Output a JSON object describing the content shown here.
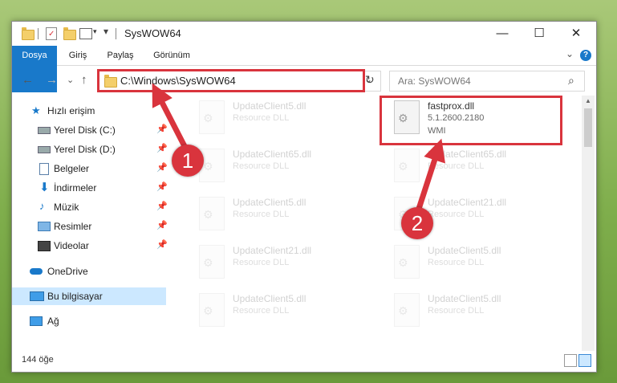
{
  "window": {
    "title": "SysWOW64",
    "minimize": "—",
    "maximize": "☐",
    "close": "✕"
  },
  "ribbon": {
    "tabs": [
      "Dosya",
      "Giriş",
      "Paylaş",
      "Görünüm"
    ],
    "help_icon": "?",
    "expand_icon": "⌄"
  },
  "address": {
    "back": "←",
    "forward": "→",
    "recent": "⌄",
    "up": "↑",
    "path": "C:\\Windows\\SysWOW64",
    "dropdown": "⌄",
    "refresh": "↻",
    "search_placeholder": "Ara: SysWOW64",
    "search_icon": "⌕"
  },
  "sidebar": {
    "items": [
      {
        "label": "Hızlı erişim",
        "icon": "star-icon",
        "pinned": false
      },
      {
        "label": "Yerel Disk (C:)",
        "icon": "drive-icon",
        "pinned": true
      },
      {
        "label": "Yerel Disk (D:)",
        "icon": "drive-icon",
        "pinned": true
      },
      {
        "label": "Belgeler",
        "icon": "documents-icon",
        "pinned": true
      },
      {
        "label": "İndirmeler",
        "icon": "download-icon",
        "pinned": true
      },
      {
        "label": "Müzik",
        "icon": "music-icon",
        "pinned": true
      },
      {
        "label": "Resimler",
        "icon": "pictures-icon",
        "pinned": true
      },
      {
        "label": "Videolar",
        "icon": "video-icon",
        "pinned": true
      },
      {
        "label": "OneDrive",
        "icon": "cloud-icon",
        "pinned": false
      },
      {
        "label": "Bu bilgisayar",
        "icon": "computer-icon",
        "pinned": false
      },
      {
        "label": "Ağ",
        "icon": "network-icon",
        "pinned": false
      }
    ],
    "pin_glyph": "📌"
  },
  "files": {
    "highlighted": {
      "name": "fastprox.dll",
      "version": "5.1.2600.2180",
      "description": "WMI"
    },
    "left_column": [
      {
        "name": "UpdateClient5.dll",
        "description": "Resource DLL"
      },
      {
        "name": "UpdateClient65.dll",
        "description": "Resource DLL"
      },
      {
        "name": "UpdateClient5.dll",
        "description": "Resource DLL"
      },
      {
        "name": "UpdateClient21.dll",
        "description": "Resource DLL"
      },
      {
        "name": "UpdateClient5.dll",
        "description": "Resource DLL"
      }
    ],
    "right_column": [
      {
        "name": "UpdateClient65.dll",
        "description": "Resource DLL"
      },
      {
        "name": "UpdateClient21.dll",
        "description": "Resource DLL"
      },
      {
        "name": "UpdateClient5.dll",
        "description": "Resource DLL"
      },
      {
        "name": "UpdateClient5.dll",
        "description": "Resource DLL"
      }
    ]
  },
  "status": {
    "item_count": "144 öğe"
  },
  "annotations": {
    "step1": "1",
    "step2": "2",
    "color": "#d9343d"
  }
}
